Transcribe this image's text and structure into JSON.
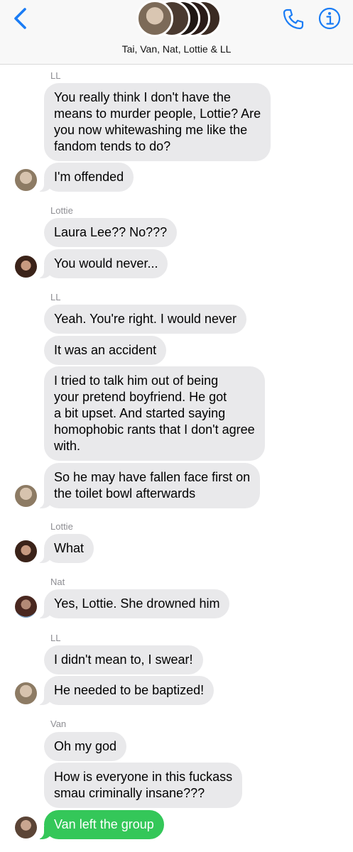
{
  "header": {
    "group_name": "Tai, Van, Nat, Lottie & LL",
    "back_icon": "chevron-left-icon",
    "phone_icon": "phone-icon",
    "info_icon": "info-icon",
    "accent_color": "#1a7cf5"
  },
  "messages": [
    {
      "sender": "LL",
      "lines": [
        "You really think I don't have the",
        "means to murder people, Lottie? Are",
        "you now whitewashing me like the",
        "fandom tends to do?"
      ]
    },
    {
      "lines": [
        "I'm offended"
      ]
    },
    {
      "sender": "Lottie",
      "lines": [
        "Laura Lee?? No???"
      ]
    },
    {
      "lines": [
        "You would never..."
      ]
    },
    {
      "sender": "LL",
      "lines": [
        "Yeah. You're right. I would never"
      ]
    },
    {
      "lines": [
        "It was an accident"
      ]
    },
    {
      "lines": [
        "I tried to talk him out of being",
        "your pretend boyfriend. He got",
        "a bit upset. And started saying",
        "homophobic rants that I don't agree",
        "with."
      ]
    },
    {
      "lines": [
        "So he may have fallen face first on",
        "the toilet bowl afterwards"
      ]
    },
    {
      "sender": "Lottie",
      "lines": [
        "What"
      ]
    },
    {
      "sender": "Nat",
      "lines": [
        "Yes, Lottie. She drowned him"
      ]
    },
    {
      "sender": "LL",
      "lines": [
        "I didn't mean to, I swear!"
      ]
    },
    {
      "lines": [
        "He needed to be baptized!"
      ]
    },
    {
      "sender": "Van",
      "lines": [
        "Oh my god"
      ]
    },
    {
      "lines": [
        "How is everyone in this fuckass",
        "smau criminally insane???"
      ]
    },
    {
      "lines": [
        "Van left the group"
      ]
    }
  ],
  "colors": {
    "bubble_gray": "#e9e9eb",
    "bubble_green": "#34c759"
  }
}
